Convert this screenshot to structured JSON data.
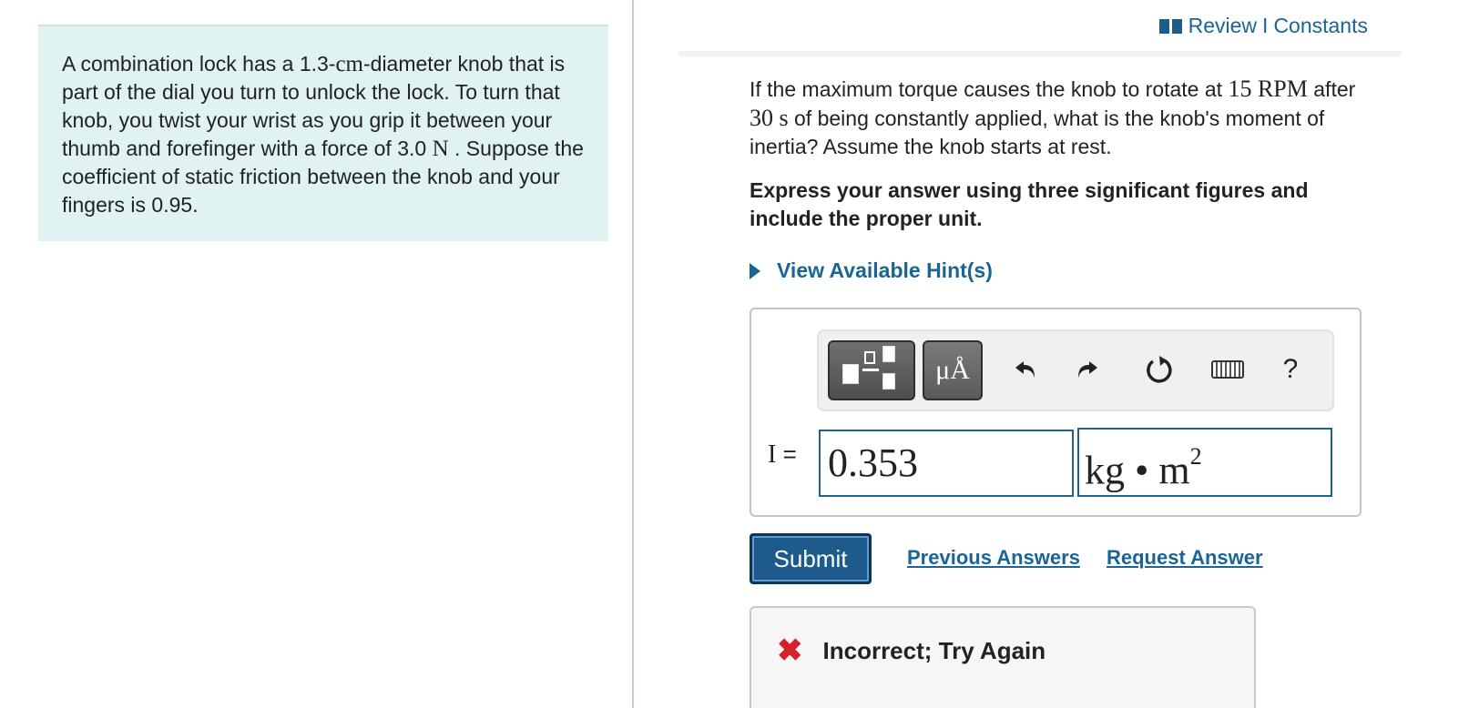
{
  "problem": {
    "segments": [
      "A combination lock has a 1.3-",
      "cm",
      "-diameter knob that is part of the dial you turn to unlock the lock. To turn that knob, you twist your wrist as you grip it between your thumb and forefinger with a force of 3.0 ",
      "N",
      " . Suppose the coefficient of static friction between the knob and your fingers is  0.95."
    ]
  },
  "header": {
    "review_label": "Review",
    "separator": "I",
    "constants_label": "Constants"
  },
  "question": {
    "part1": "If the maximum torque causes the knob to rotate at ",
    "rpm_value": "15 RPM",
    "part2": " after ",
    "time_value": "30 s",
    "part3": " of being constantly applied, what is the knob's moment of inertia?  Assume the knob starts at rest."
  },
  "instructions": "Express your answer using three significant figures and include the proper unit.",
  "hints_label": "View Available Hint(s)",
  "toolbar": {
    "units_label": "μÅ",
    "help_label": "?",
    "icons": [
      "templates-icon",
      "units-icon",
      "undo-icon",
      "redo-icon",
      "reset-icon",
      "keyboard-icon",
      "help-icon"
    ]
  },
  "answer": {
    "variable_label": "I",
    "equals": "=",
    "value": "0.353",
    "unit_base": "kg • m",
    "unit_exponent": "2"
  },
  "actions": {
    "submit_label": "Submit",
    "previous_answers_label": "Previous Answers",
    "request_answer_label": "Request Answer"
  },
  "feedback": {
    "message": "Incorrect; Try Again",
    "status_color": "#d2232a"
  },
  "colors": {
    "panel_bg": "#e1f2f2",
    "link": "#1a6496",
    "submit_bg": "#1c5b8b"
  }
}
